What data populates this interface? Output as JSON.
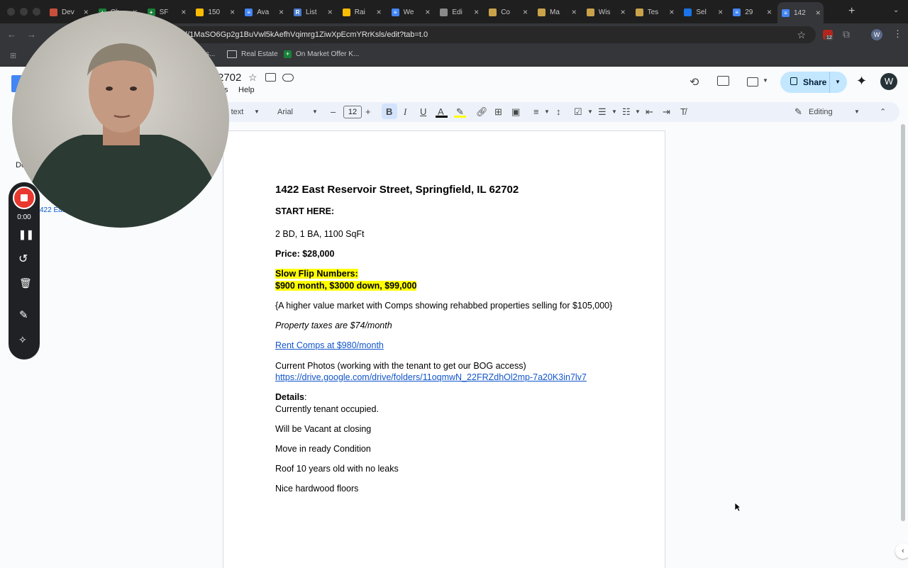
{
  "browser": {
    "tabs": [
      {
        "title": "Dev",
        "color": "#c94f3c",
        "glyph": ""
      },
      {
        "title": "Ch",
        "color": "#188038",
        "glyph": "+"
      },
      {
        "title": "SF",
        "color": "#188038",
        "glyph": "+"
      },
      {
        "title": "150",
        "color": "#fbbc04",
        "glyph": ""
      },
      {
        "title": "Ava",
        "color": "#4285f4",
        "glyph": "≡"
      },
      {
        "title": "List",
        "color": "#4a7cd0",
        "glyph": "R"
      },
      {
        "title": "Rai",
        "color": "#fbbc04",
        "glyph": ""
      },
      {
        "title": "We",
        "color": "#4285f4",
        "glyph": "≡"
      },
      {
        "title": "Edi",
        "color": "#8a8a8a",
        "glyph": ""
      },
      {
        "title": "Co",
        "color": "#c9a24a",
        "glyph": ""
      },
      {
        "title": "Ma",
        "color": "#c9a24a",
        "glyph": ""
      },
      {
        "title": "Wis",
        "color": "#c9a24a",
        "glyph": ""
      },
      {
        "title": "Tes",
        "color": "#c9a24a",
        "glyph": ""
      },
      {
        "title": "Sel",
        "color": "#1a73e8",
        "glyph": ""
      },
      {
        "title": "29",
        "color": "#4285f4",
        "glyph": "≡"
      },
      {
        "title": "142",
        "color": "#4285f4",
        "glyph": "≡"
      }
    ],
    "url": "d/1MaSO6Gp2g1BuVwl5kAefhVqimrg1ZiwXpEcmYRrKsls/edit?tab=t.0",
    "bookmarks": [
      {
        "label": "Real Estate",
        "icon": "folder-icon"
      },
      {
        "label": "On Market Offer K...",
        "icon": "sheets-icon"
      }
    ],
    "profile_initial": "W",
    "extension_badge": "12"
  },
  "docs": {
    "title_fragment": "2702",
    "menu_visible": [
      "s",
      "Help"
    ],
    "share_label": "Share",
    "avatar_initial": "W",
    "style_select": "al text",
    "font_select": "Arial",
    "font_size": "12",
    "mode_label": "Editing",
    "outline_fragment": "Do",
    "outline_item": "422 East"
  },
  "document": {
    "heading": "1422 East Reservoir Street, Springfield, IL 62702",
    "start_here": "START HERE:",
    "specs": "2 BD, 1 BA, 1100 SqFt",
    "price": "Price: $28,000",
    "slow_flip_title": "Slow Flip Numbers:",
    "slow_flip_terms": "$900 month, $3000 down, $99,000",
    "market_note": "{A higher value market with Comps showing rehabbed properties selling for $105,000}",
    "taxes": "Property taxes are $74/month",
    "rent_comps": "Rent Comps at $980/month",
    "photos_note": "Current Photos (working with the tenant to get our BOG access)",
    "photos_url": "https://drive.google.com/drive/folders/11oqmwN_22FRZdhOl2mp-7a20K3in7lv7",
    "details_label": "Details",
    "details_colon": ":",
    "occupancy": "Currently tenant occupied.",
    "vacant": "Will be Vacant at closing",
    "condition": "Move in ready Condition",
    "roof": "Roof 10 years old with no leaks",
    "floors": "Nice hardwood floors"
  },
  "recorder": {
    "timer": "0:00"
  },
  "colors": {
    "highlight": "#ffff00",
    "link": "#1155cc",
    "share_bg": "#c2e7ff",
    "record_red": "#e8382f"
  }
}
